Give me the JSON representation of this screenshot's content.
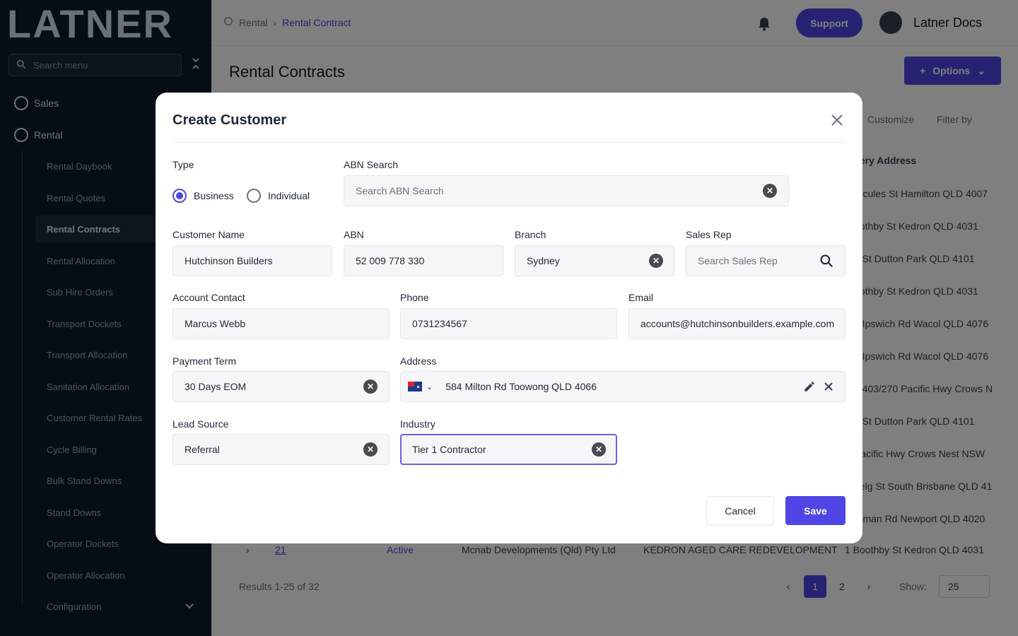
{
  "sidebar": {
    "logo": "LATNER",
    "search_placeholder": "Search menu",
    "groups": [
      {
        "label": "Sales"
      },
      {
        "label": "Rental"
      }
    ],
    "items": [
      {
        "label": "Rental Daybook"
      },
      {
        "label": "Rental Quotes"
      },
      {
        "label": "Rental Contracts"
      },
      {
        "label": "Rental Allocation"
      },
      {
        "label": "Sub Hire Orders"
      },
      {
        "label": "Transport Dockets"
      },
      {
        "label": "Transport Allocation"
      },
      {
        "label": "Sanitation Allocation"
      },
      {
        "label": "Customer Rental Rates"
      },
      {
        "label": "Cycle Billing"
      },
      {
        "label": "Bulk Stand Downs"
      },
      {
        "label": "Stand Downs"
      },
      {
        "label": "Operator Dockets"
      },
      {
        "label": "Operator Allocation"
      },
      {
        "label": "Configuration"
      }
    ],
    "active_item": "Rental Contracts"
  },
  "header": {
    "breadcrumb": [
      "Rental",
      "Rental Contracts"
    ],
    "breadcrumb_current": "Rental Contract",
    "support_label": "Support",
    "user_name": "Latner Docs"
  },
  "page": {
    "title": "Rental Contracts",
    "options_label": "Options",
    "customize_label": "Customize",
    "filter_label": "Filter by",
    "column_header": "very Address",
    "addresses": [
      "ercules St Hamilton QLD 4007",
      "oothby St Kedron QLD 4031",
      "n St Dutton Park QLD 4101",
      "oothby St Kedron QLD 4031",
      "3 Ipswich Rd Wacol QLD 4076",
      "3 Ipswich Rd Wacol QLD 4076",
      "e 403/270 Pacific Hwy Crows N",
      "n St Dutton Park QLD 4101",
      "Pacific Hwy Crows Nest NSW",
      "nelg St South Brisbane QLD 41",
      "rdman Rd Newport QLD 4020"
    ],
    "last_row": {
      "id": "21",
      "status": "Active",
      "customer": "Mcnab Developments (Qld) Pty Ltd",
      "project": "KEDRON AGED CARE REDEVELOPMENT",
      "address": "1 Boothby St Kedron QLD 4031"
    },
    "results_label": "Results 1-25 of 32",
    "pages": [
      "1",
      "2"
    ],
    "show_label": "Show:",
    "page_size": "25"
  },
  "modal": {
    "title": "Create Customer",
    "type_label": "Type",
    "type_options": [
      "Business",
      "Individual"
    ],
    "type_selected": "Business",
    "abn_search_label": "ABN Search",
    "abn_search_placeholder": "Search ABN Search",
    "customer_name_label": "Customer Name",
    "customer_name": "Hutchinson Builders",
    "abn_label": "ABN",
    "abn": "52 009 778 330",
    "branch_label": "Branch",
    "branch": "Sydney",
    "sales_rep_label": "Sales Rep",
    "sales_rep_placeholder": "Search Sales Rep",
    "account_contact_label": "Account Contact",
    "account_contact": "Marcus Webb",
    "phone_label": "Phone",
    "phone": "0731234567",
    "email_label": "Email",
    "email": "accounts@hutchinsonbuilders.example.com",
    "payment_term_label": "Payment Term",
    "payment_term": "30 Days EOM",
    "address_label": "Address",
    "address": "584 Milton Rd Toowong QLD 4066",
    "lead_source_label": "Lead Source",
    "lead_source": "Referral",
    "industry_label": "Industry",
    "industry": "Tier 1 Contractor",
    "cancel_label": "Cancel",
    "save_label": "Save"
  },
  "colors": {
    "accent": "#4f46e5",
    "sidebar_bg": "#0f1a2b",
    "focus_border": "#6d5fe8"
  }
}
